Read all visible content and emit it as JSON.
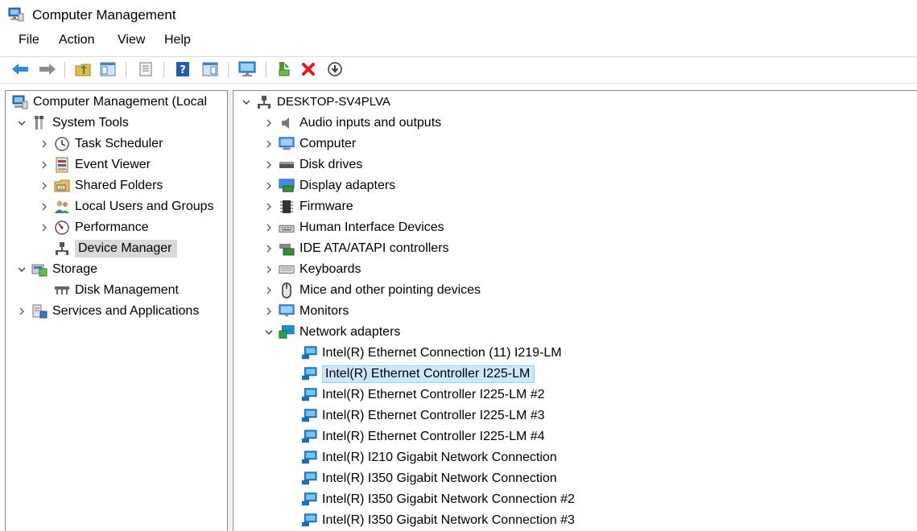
{
  "window": {
    "title": "Computer Management"
  },
  "menu": [
    "File",
    "Action",
    "View",
    "Help"
  ],
  "toolbar": {
    "icons": [
      "back-icon",
      "forward-icon",
      "up-folder-icon",
      "show-hide-console-tree-icon",
      "properties-icon",
      "help-icon",
      "show-hide-action-pane-icon",
      "monitor-icon",
      "update-driver-icon",
      "uninstall-device-icon",
      "disable-device-icon"
    ]
  },
  "left_tree": {
    "root": "Computer Management (Local",
    "system_tools": "System Tools",
    "task_scheduler": "Task Scheduler",
    "event_viewer": "Event Viewer",
    "shared_folders": "Shared Folders",
    "local_users": "Local Users and Groups",
    "performance": "Performance",
    "device_manager": "Device Manager",
    "storage": "Storage",
    "disk_management": "Disk Management",
    "services": "Services and Applications"
  },
  "device_tree": {
    "computer_name": "DESKTOP-SV4PLVA",
    "categories": [
      "Audio inputs and outputs",
      "Computer",
      "Disk drives",
      "Display adapters",
      "Firmware",
      "Human Interface Devices",
      "IDE ATA/ATAPI controllers",
      "Keyboards",
      "Mice and other pointing devices",
      "Monitors",
      "Network adapters"
    ],
    "network_adapters": [
      "Intel(R) Ethernet Connection (11) I219-LM",
      "Intel(R) Ethernet Controller I225-LM",
      "Intel(R) Ethernet Controller I225-LM #2",
      "Intel(R) Ethernet Controller I225-LM #3",
      "Intel(R) Ethernet Controller I225-LM #4",
      "Intel(R) I210 Gigabit Network Connection",
      "Intel(R) I350 Gigabit Network Connection",
      "Intel(R) I350 Gigabit Network Connection #2",
      "Intel(R) I350 Gigabit Network Connection #3"
    ],
    "selected_index": 1
  },
  "colors": {
    "selection_blue": "#cce8ff",
    "selection_gray": "#d9d9d9",
    "network_icon": "#1e8fd6"
  }
}
